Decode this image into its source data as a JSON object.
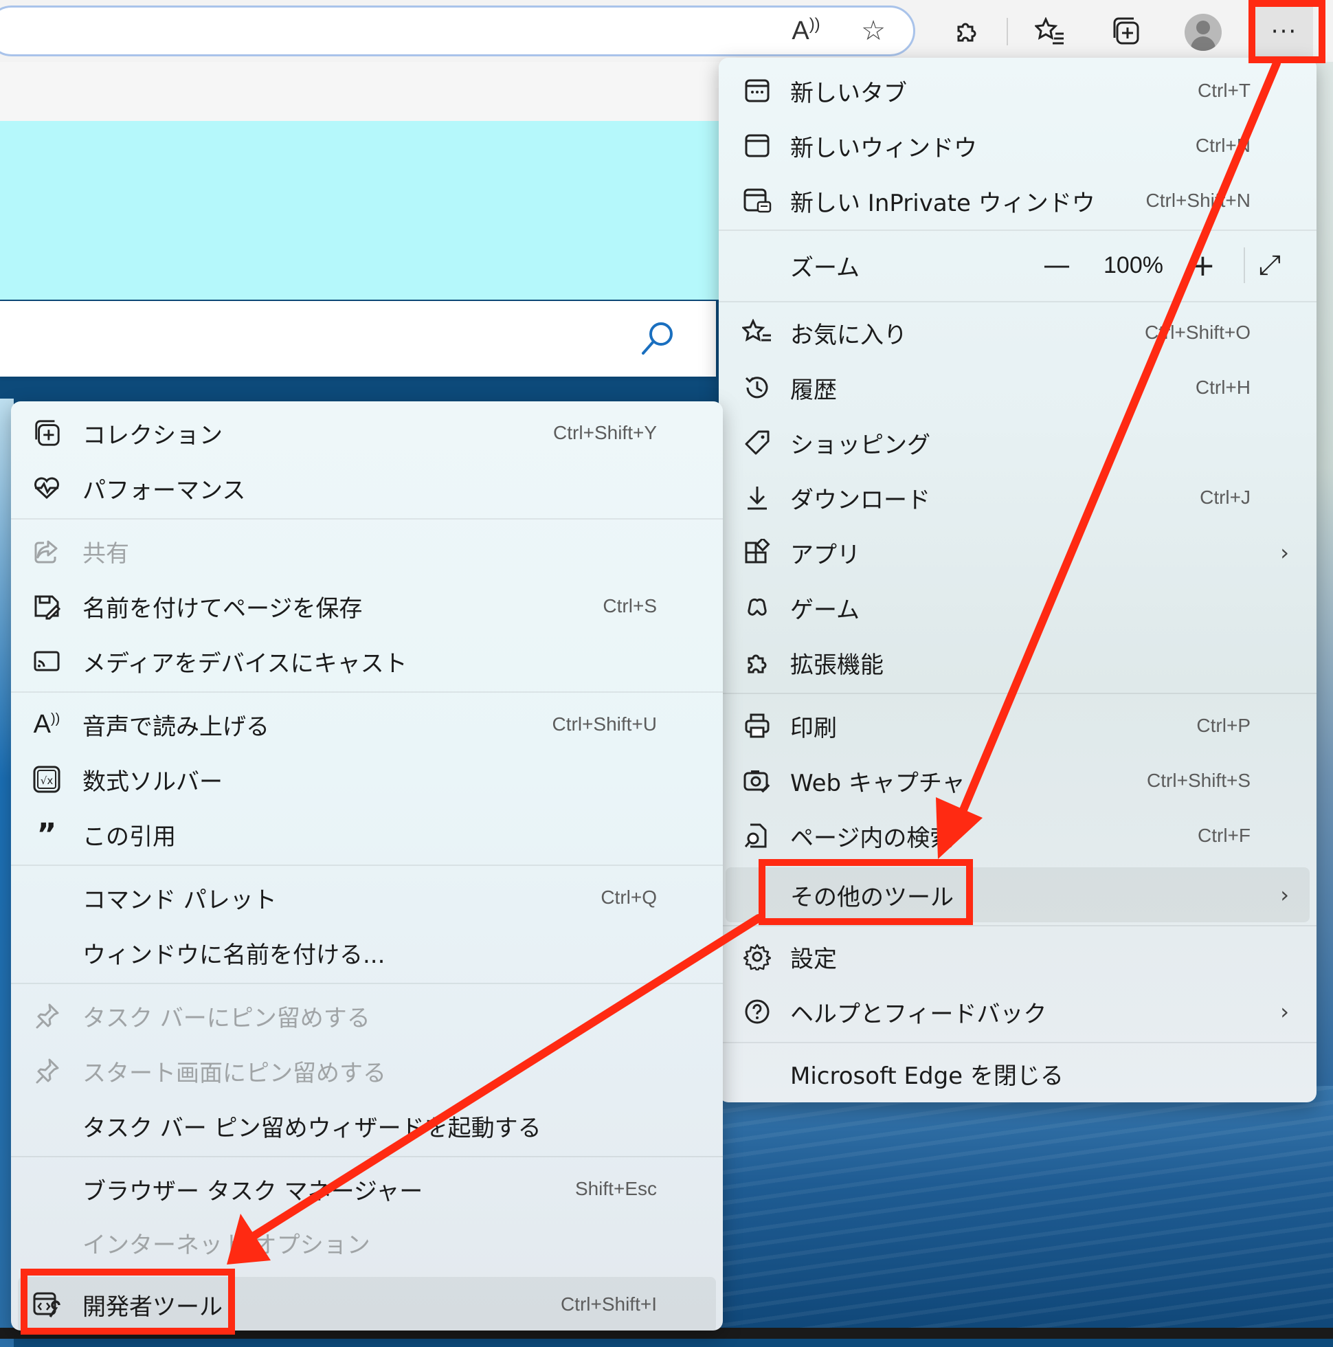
{
  "toolbar": {
    "read_aloud_glyph": "Aͅ",
    "more_button_label": "···"
  },
  "main_menu": {
    "items": [
      {
        "label": "新しいタブ",
        "shortcut": "Ctrl+T",
        "icon": "new-tab-icon"
      },
      {
        "label": "新しいウィンドウ",
        "shortcut": "Ctrl+N",
        "icon": "new-window-icon"
      },
      {
        "label": "新しい InPrivate ウィンドウ",
        "shortcut": "Ctrl+Shift+N",
        "icon": "inprivate-icon"
      },
      {
        "label": "お気に入り",
        "shortcut": "Ctrl+Shift+O",
        "icon": "favorites-icon"
      },
      {
        "label": "履歴",
        "shortcut": "Ctrl+H",
        "icon": "history-icon"
      },
      {
        "label": "ショッピング",
        "shortcut": "",
        "icon": "shopping-tag-icon"
      },
      {
        "label": "ダウンロード",
        "shortcut": "Ctrl+J",
        "icon": "download-icon"
      },
      {
        "label": "アプリ",
        "shortcut": "",
        "icon": "apps-icon"
      },
      {
        "label": "ゲーム",
        "shortcut": "",
        "icon": "games-icon"
      },
      {
        "label": "拡張機能",
        "shortcut": "",
        "icon": "extensions-icon"
      },
      {
        "label": "印刷",
        "shortcut": "Ctrl+P",
        "icon": "print-icon"
      },
      {
        "label": "Web キャプチャ",
        "shortcut": "Ctrl+Shift+S",
        "icon": "web-capture-icon"
      },
      {
        "label": "ページ内の検索",
        "shortcut": "Ctrl+F",
        "icon": "find-in-page-icon"
      },
      {
        "label": "その他のツール",
        "shortcut": "",
        "icon": ""
      },
      {
        "label": "設定",
        "shortcut": "",
        "icon": "settings-gear-icon"
      },
      {
        "label": "ヘルプとフィードバック",
        "shortcut": "",
        "icon": "help-icon"
      },
      {
        "label": "Microsoft Edge を閉じる",
        "shortcut": "",
        "icon": ""
      }
    ],
    "zoom": {
      "label": "ズーム",
      "minus": "—",
      "value": "100%",
      "plus": "+",
      "fullscreen": "⤢"
    }
  },
  "sub_menu": {
    "items": [
      {
        "label": "コレクション",
        "shortcut": "Ctrl+Shift+Y",
        "icon": "collections-icon",
        "enabled": true
      },
      {
        "label": "パフォーマンス",
        "shortcut": "",
        "icon": "performance-heart-icon",
        "enabled": true
      },
      {
        "label": "共有",
        "shortcut": "",
        "icon": "share-icon",
        "enabled": false
      },
      {
        "label": "名前を付けてページを保存",
        "shortcut": "Ctrl+S",
        "icon": "save-page-icon",
        "enabled": true
      },
      {
        "label": "メディアをデバイスにキャスト",
        "shortcut": "",
        "icon": "cast-icon",
        "enabled": true
      },
      {
        "label": "音声で読み上げる",
        "shortcut": "Ctrl+Shift+U",
        "icon": "read-aloud-icon",
        "enabled": true
      },
      {
        "label": "数式ソルバー",
        "shortcut": "",
        "icon": "math-solver-icon",
        "enabled": true
      },
      {
        "label": "この引用",
        "shortcut": "",
        "icon": "quote-icon",
        "enabled": true
      },
      {
        "label": "コマンド パレット",
        "shortcut": "Ctrl+Q",
        "icon": "",
        "enabled": true
      },
      {
        "label": "ウィンドウに名前を付ける...",
        "shortcut": "",
        "icon": "",
        "enabled": true
      },
      {
        "label": "タスク バーにピン留めする",
        "shortcut": "",
        "icon": "pin-icon",
        "enabled": false
      },
      {
        "label": "スタート画面にピン留めする",
        "shortcut": "",
        "icon": "pin-icon",
        "enabled": false
      },
      {
        "label": "タスク バー ピン留めウィザードを起動する",
        "shortcut": "",
        "icon": "",
        "enabled": true
      },
      {
        "label": "ブラウザー タスク マネージャー",
        "shortcut": "Shift+Esc",
        "icon": "",
        "enabled": true
      },
      {
        "label": "インターネット オプション",
        "shortcut": "",
        "icon": "",
        "enabled": false
      },
      {
        "label": "開発者ツール",
        "shortcut": "Ctrl+Shift+I",
        "icon": "developer-tools-icon",
        "enabled": true
      }
    ]
  },
  "colors": {
    "annotation": "#ff2a12",
    "banner": "#b5f8fb",
    "search_icon": "#1a6fbf"
  }
}
